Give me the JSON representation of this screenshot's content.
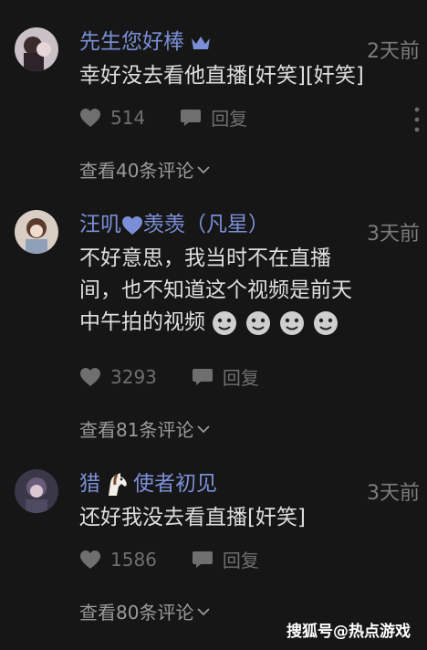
{
  "comments": [
    {
      "username": "先生您好棒",
      "time": "2天前",
      "text": "幸好没去看他直播[奸笑][奸笑]",
      "likes": "514",
      "reply_label": "回复",
      "more_label": "查看40条评论"
    },
    {
      "username_part1": "汪叽",
      "username_part2": "羡羡（凡星）",
      "time": "3天前",
      "text_line1": "不好意思，我当时不在直播",
      "text_line2": "间，也不知道这个视频是前天",
      "text_line3": "中午拍的视频",
      "likes": "3293",
      "reply_label": "回复",
      "more_label": "查看81条评论"
    },
    {
      "username_part1": "猎",
      "username_part2": "使者初见",
      "time": "3天前",
      "text": "还好我没去看直播[奸笑]",
      "likes": "1586",
      "reply_label": "回复",
      "more_label": "查看80条评论"
    }
  ],
  "watermark": "搜狐号@热点游戏",
  "colors": {
    "background": "#161616",
    "username": "#7b8fd6",
    "text": "#dedede",
    "muted": "#6f6f6f"
  }
}
